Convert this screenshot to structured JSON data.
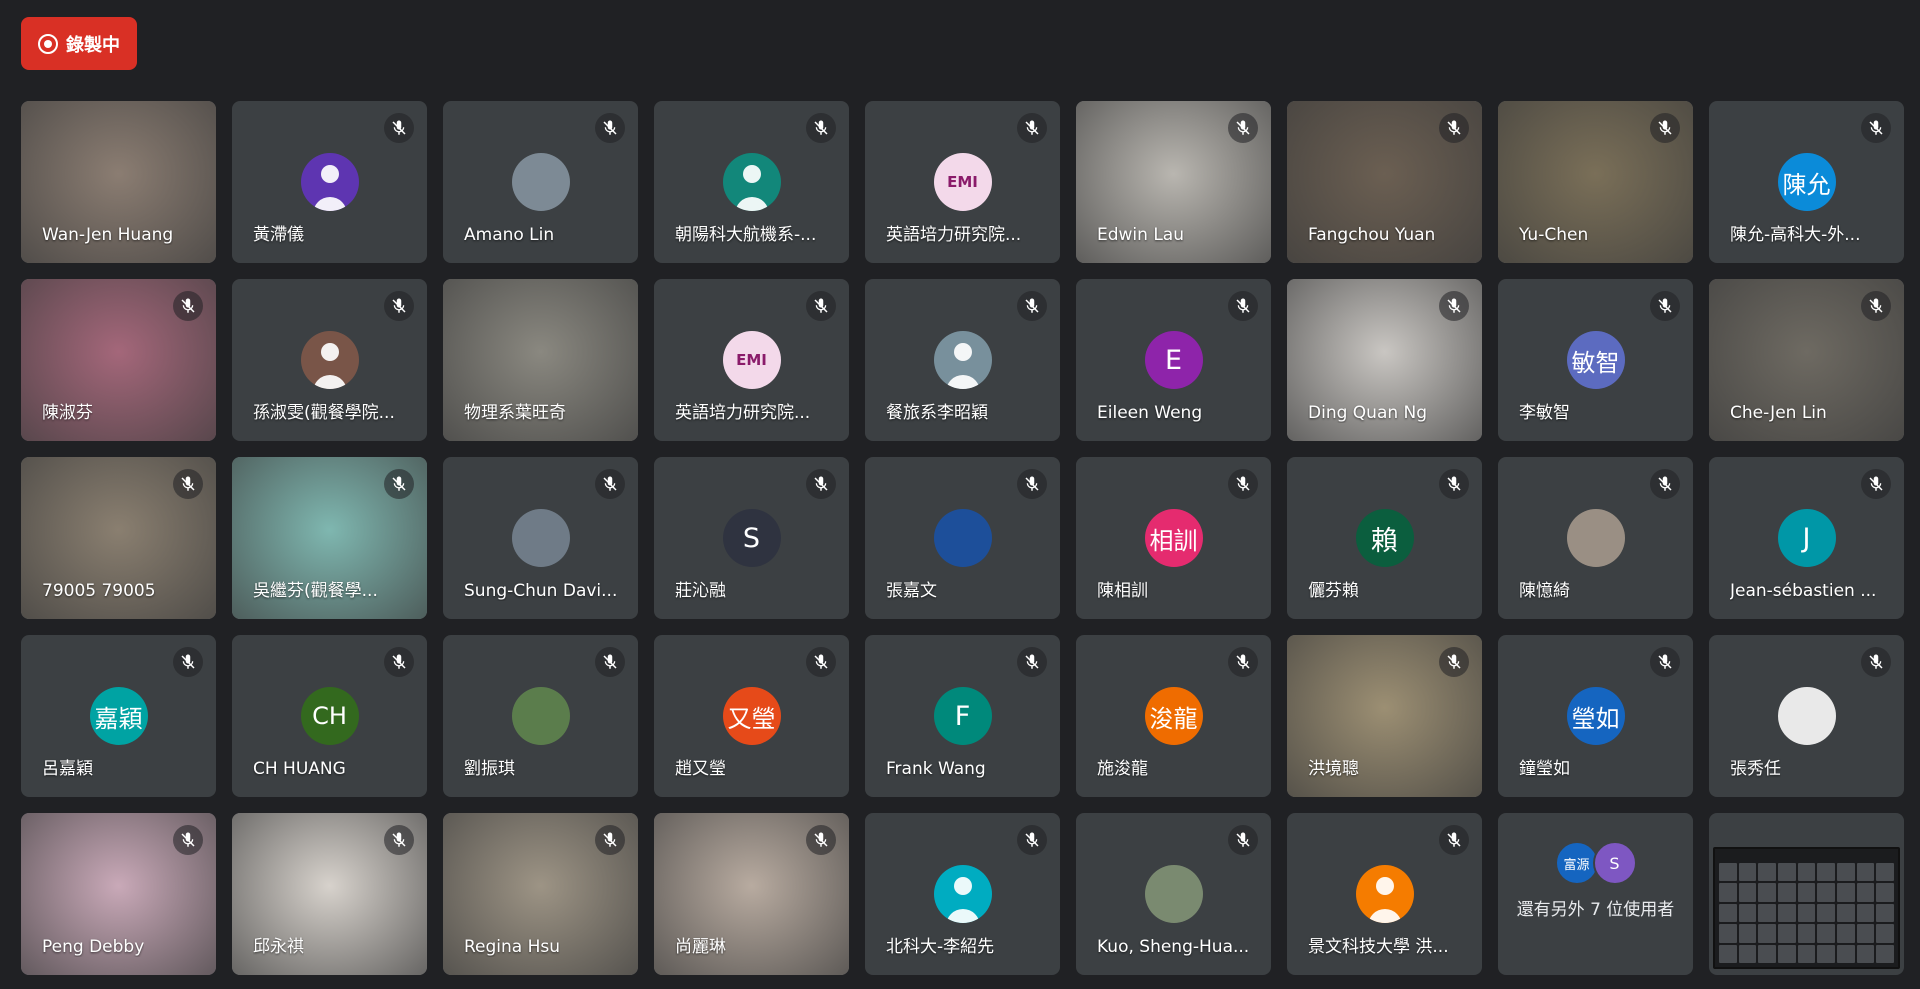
{
  "recording": {
    "label": "錄製中",
    "color": "#d93025"
  },
  "participants": [
    {
      "name": "Wan-Jen Huang",
      "type": "video",
      "bg": "#8b7d72",
      "muted": false
    },
    {
      "name": "黃滯儀",
      "type": "avatar",
      "initials": "",
      "color": "#5e35b1",
      "muted": true
    },
    {
      "name": "Amano Lin",
      "type": "photo",
      "initials": "",
      "color": "#7d8a95",
      "muted": true
    },
    {
      "name": "朝陽科大航機系-...",
      "type": "avatar",
      "initials": "",
      "color": "#12877a",
      "muted": true
    },
    {
      "name": "英語培力研究院...",
      "type": "avatar",
      "initials": "EMI",
      "color": "#f3d9ea",
      "muted": true
    },
    {
      "name": "Edwin Lau",
      "type": "video",
      "bg": "#b9b6b0",
      "muted": true
    },
    {
      "name": "Fangchou Yuan",
      "type": "video",
      "bg": "#6b5f52",
      "muted": true
    },
    {
      "name": "Yu-Chen",
      "type": "video",
      "bg": "#7a6f58",
      "muted": true
    },
    {
      "name": "陳允-高科大-外...",
      "type": "avatar",
      "initials": "陳允",
      "color": "#0b8bd9",
      "muted": true
    },
    {
      "name": "陳淑芬",
      "type": "video",
      "bg": "#a4677a",
      "muted": true
    },
    {
      "name": "孫淑雯(觀餐學院...",
      "type": "avatar",
      "initials": "",
      "color": "#795548",
      "muted": true
    },
    {
      "name": "物理系葉旺奇",
      "type": "video",
      "bg": "#8a8880",
      "muted": false
    },
    {
      "name": "英語培力研究院...",
      "type": "avatar",
      "initials": "EMI",
      "color": "#f3d9ea",
      "muted": true
    },
    {
      "name": "餐旅系李昭穎",
      "type": "avatar",
      "initials": "",
      "color": "#78909c",
      "muted": true
    },
    {
      "name": "Eileen Weng",
      "type": "avatar",
      "initials": "E",
      "color": "#8e24aa",
      "muted": true
    },
    {
      "name": "Ding Quan Ng",
      "type": "video",
      "bg": "#c9c6c2",
      "muted": true
    },
    {
      "name": "李敏智",
      "type": "avatar",
      "initials": "敏智",
      "color": "#5c6bc0",
      "muted": true
    },
    {
      "name": "Che-Jen Lin",
      "type": "video",
      "bg": "#6e6a62",
      "muted": true
    },
    {
      "name": "79005 79005",
      "type": "video",
      "bg": "#8a7f70",
      "muted": true
    },
    {
      "name": "吳繼芬(觀餐學...",
      "type": "video",
      "bg": "#7fb7b0",
      "muted": true
    },
    {
      "name": "Sung-Chun Davi...",
      "type": "photo",
      "initials": "",
      "color": "#6f7b87",
      "muted": true
    },
    {
      "name": "莊沁融",
      "type": "avatar",
      "initials": "S",
      "color": "#2f3340",
      "muted": true
    },
    {
      "name": "張嘉文",
      "type": "photo",
      "initials": "",
      "color": "#1d4f9a",
      "muted": true
    },
    {
      "name": "陳相訓",
      "type": "avatar",
      "initials": "相訓",
      "color": "#e52b6f",
      "muted": true
    },
    {
      "name": "儷芬賴",
      "type": "avatar",
      "initials": "賴",
      "color": "#0b5e3e",
      "muted": true
    },
    {
      "name": "陳憶綺",
      "type": "photo",
      "initials": "",
      "color": "#9a8f84",
      "muted": true
    },
    {
      "name": "Jean-sébastien ...",
      "type": "avatar",
      "initials": "J",
      "color": "#0097a7",
      "muted": true
    },
    {
      "name": "呂嘉穎",
      "type": "avatar",
      "initials": "嘉穎",
      "color": "#00a3a3",
      "muted": true
    },
    {
      "name": "CH HUANG",
      "type": "avatar",
      "initials": "CH",
      "color": "#33691e",
      "muted": true
    },
    {
      "name": "劉振琪",
      "type": "photo",
      "initials": "",
      "color": "#5b7d4c",
      "muted": true
    },
    {
      "name": "趙又瑩",
      "type": "avatar",
      "initials": "又瑩",
      "color": "#e64a19",
      "muted": true
    },
    {
      "name": "Frank Wang",
      "type": "avatar",
      "initials": "F",
      "color": "#00897b",
      "muted": true
    },
    {
      "name": "施浚龍",
      "type": "avatar",
      "initials": "浚龍",
      "color": "#ef6c00",
      "muted": true
    },
    {
      "name": "洪境聰",
      "type": "video",
      "bg": "#9c8f73",
      "muted": true
    },
    {
      "name": "鐘瑩如",
      "type": "avatar",
      "initials": "瑩如",
      "color": "#1565c0",
      "muted": true
    },
    {
      "name": "張秀任",
      "type": "photo",
      "initials": "",
      "color": "#e9e9e9",
      "muted": true
    },
    {
      "name": "Peng Debby",
      "type": "video",
      "bg": "#c9a9b8",
      "muted": true
    },
    {
      "name": "邱永祺",
      "type": "video",
      "bg": "#d7d2cc",
      "muted": true
    },
    {
      "name": "Regina Hsu",
      "type": "video",
      "bg": "#9d9485",
      "muted": true
    },
    {
      "name": "尚麗琳",
      "type": "video",
      "bg": "#b8aba0",
      "muted": true
    },
    {
      "name": "北科大-李紹先",
      "type": "avatar",
      "initials": "",
      "color": "#00acc1",
      "muted": true
    },
    {
      "name": "Kuo, Sheng-Hua...",
      "type": "photo",
      "initials": "",
      "color": "#7a8a70",
      "muted": true
    },
    {
      "name": "景文科技大學 洪...",
      "type": "avatar",
      "initials": "",
      "color": "#f57c00",
      "muted": true
    }
  ],
  "more": {
    "label": "還有另外 7 位使用者",
    "avatars": [
      {
        "initials": "富源",
        "color": "#1565c0"
      },
      {
        "initials": "S",
        "color": "#7e57c2"
      }
    ]
  },
  "icons": {
    "mic_off": "mic-off-icon",
    "default_avatar": "person-icon",
    "record": "record-icon"
  }
}
